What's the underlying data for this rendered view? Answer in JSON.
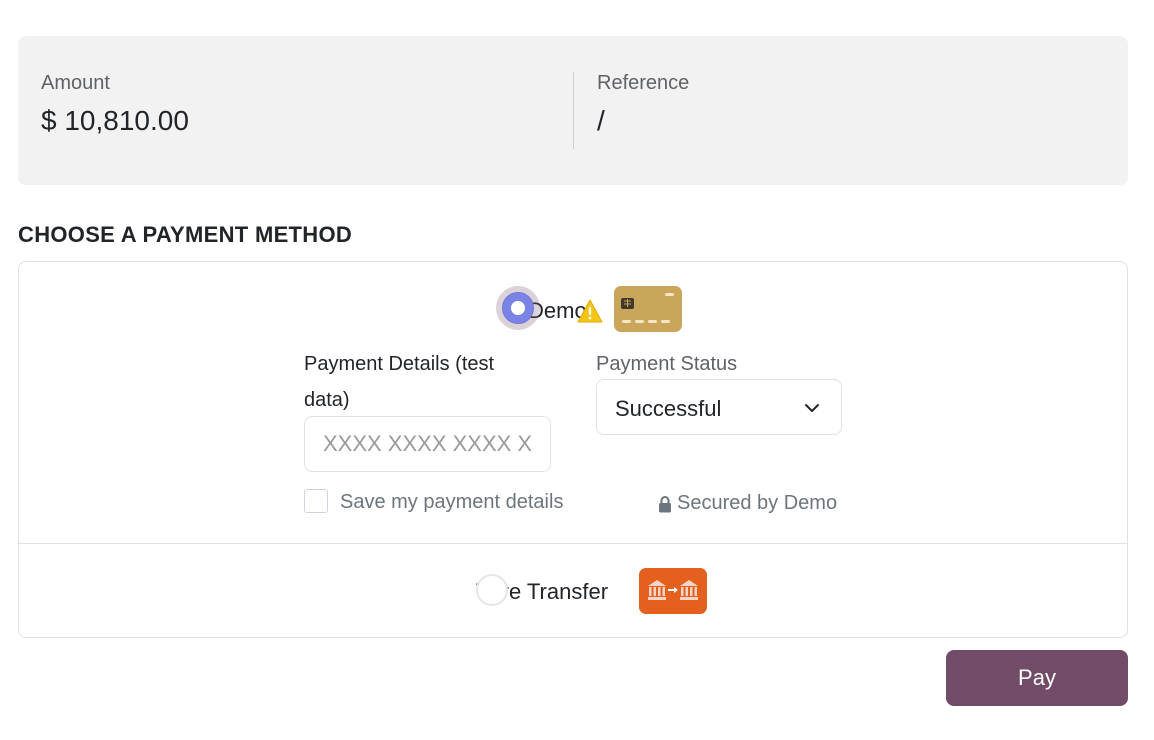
{
  "summary": {
    "amount_label": "Amount",
    "amount_value": "$ 10,810.00",
    "reference_label": "Reference",
    "reference_value": "/"
  },
  "payment": {
    "heading": "CHOOSE A PAYMENT METHOD",
    "methods": [
      {
        "label": "Demo",
        "selected": true,
        "icons": [
          "warning-icon",
          "credit-card-icon"
        ]
      },
      {
        "label": "Wire Transfer",
        "selected": false,
        "icons": [
          "bank-transfer-icon"
        ]
      }
    ],
    "demo_form": {
      "details_label": "Payment Details (test data)",
      "card_placeholder": "XXXX XXXX XXXX XXXX",
      "status_label": "Payment Status",
      "status_value": "Successful",
      "save_label": "Save my payment details",
      "save_checked": false,
      "secured_label": "Secured by Demo"
    }
  },
  "actions": {
    "pay_label": "Pay"
  },
  "colors": {
    "primary": "#714b67",
    "radio_selected": "#7b84e6",
    "warning": "#f5c518",
    "card_gold": "#c9a65a",
    "bank_orange": "#e3601f",
    "panel_bg": "#f2f2f2"
  }
}
